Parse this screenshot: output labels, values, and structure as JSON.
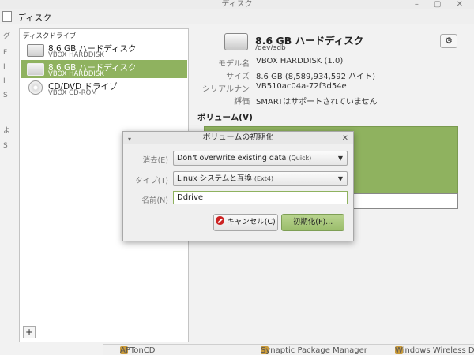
{
  "window": {
    "title": "ディスク",
    "app_title": "ディスク",
    "controls": "– ▢ ✕"
  },
  "stray_letters": [
    "グ",
    "F",
    "I",
    "I",
    "S",
    "よ",
    "S"
  ],
  "drives": {
    "section_title": "ディスクドライブ",
    "items": [
      {
        "name": "8.6 GB ハードディスク",
        "sub": "VBOX HARDDISK",
        "icon": "hard-disk-icon",
        "selected": false
      },
      {
        "name": "8.6 GB ハードディスク",
        "sub": "VBOX HARDDISK",
        "icon": "hard-disk-icon",
        "selected": true
      },
      {
        "name": "CD/DVD ドライブ",
        "sub": "VBOX CD-ROM",
        "icon": "optical-disc-icon",
        "selected": false
      }
    ],
    "add_label": "+"
  },
  "detail": {
    "title": "8.6 GB ハードディスク",
    "device": "/dev/sdb",
    "gear_label": "⚙",
    "properties": [
      {
        "key": "モデル名",
        "value": "VBOX HARDDISK (1.0)"
      },
      {
        "key": "サイズ",
        "value": "8.6 GB (8,589,934,592 バイト)"
      },
      {
        "key": "シリアルナンバー",
        "value": "VB510ac04a-72f3d54e"
      },
      {
        "key": "評価",
        "value": "SMARTはサポートされていません"
      }
    ],
    "volumes_label": "ボリューム(V)"
  },
  "dialog": {
    "title": "ボリュームの初期化",
    "minimize": "▾",
    "close": "✕",
    "erase_label": "消去(E)",
    "erase_value": "Don't overwrite existing data",
    "erase_hint": "(Quick)",
    "type_label": "タイプ(T)",
    "type_value": "Linux システムと互換",
    "type_hint": "(Ext4)",
    "name_label": "名前(N)",
    "name_value": "Ddrive",
    "cancel_label": "キャンセル(C)",
    "format_label": "初期化(F)..."
  },
  "taskbar": {
    "items": [
      "APTonCD",
      "Synaptic Package Manager",
      "Windows Wireless Driv"
    ]
  },
  "colors": {
    "selection": "#8fb25f",
    "window_bg": "#f2f2f2",
    "cancel_icon": "#cc2222"
  }
}
